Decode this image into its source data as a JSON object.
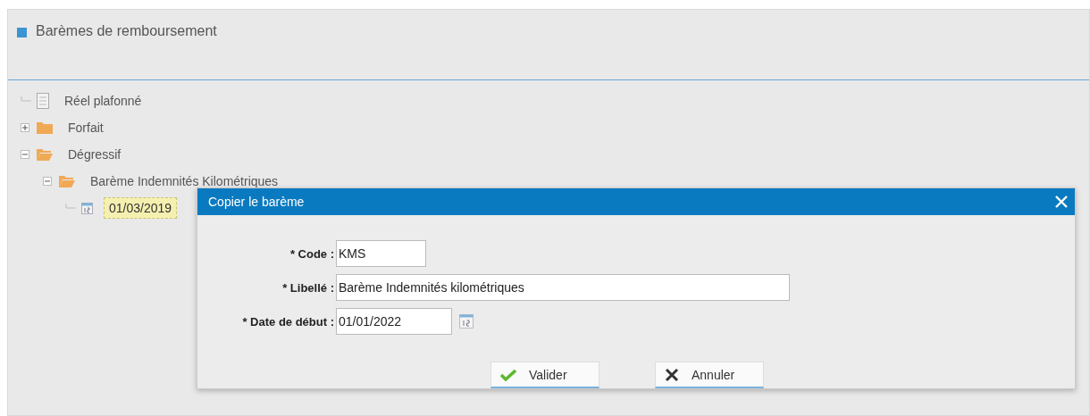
{
  "panel": {
    "title": "Barèmes de remboursement"
  },
  "tree": [
    {
      "label": "Réel plafonné",
      "kind": "document",
      "selected": false
    },
    {
      "label": "Forfait",
      "kind": "folder",
      "expanded": false,
      "selected": false
    },
    {
      "label": "Dégressif",
      "kind": "folder",
      "expanded": true,
      "selected": false,
      "children": [
        {
          "label": "Barème Indemnités Kilométriques",
          "kind": "folder",
          "expanded": true,
          "selected": false,
          "children": [
            {
              "label": "01/03/2019",
              "kind": "date",
              "selected": true
            }
          ]
        }
      ]
    }
  ],
  "dialog": {
    "title": "Copier le barème",
    "fields": [
      {
        "label": "* Code :",
        "value": "KMS",
        "kind": "short"
      },
      {
        "label": "* Libellé :",
        "value": "Barème Indemnités kilométriques",
        "kind": "long"
      },
      {
        "label": "* Date de début :",
        "value": "01/01/2022",
        "kind": "date"
      }
    ],
    "buttons": [
      {
        "label": "Valider",
        "kind": "ok"
      },
      {
        "label": "Annuler",
        "kind": "cancel"
      }
    ]
  }
}
